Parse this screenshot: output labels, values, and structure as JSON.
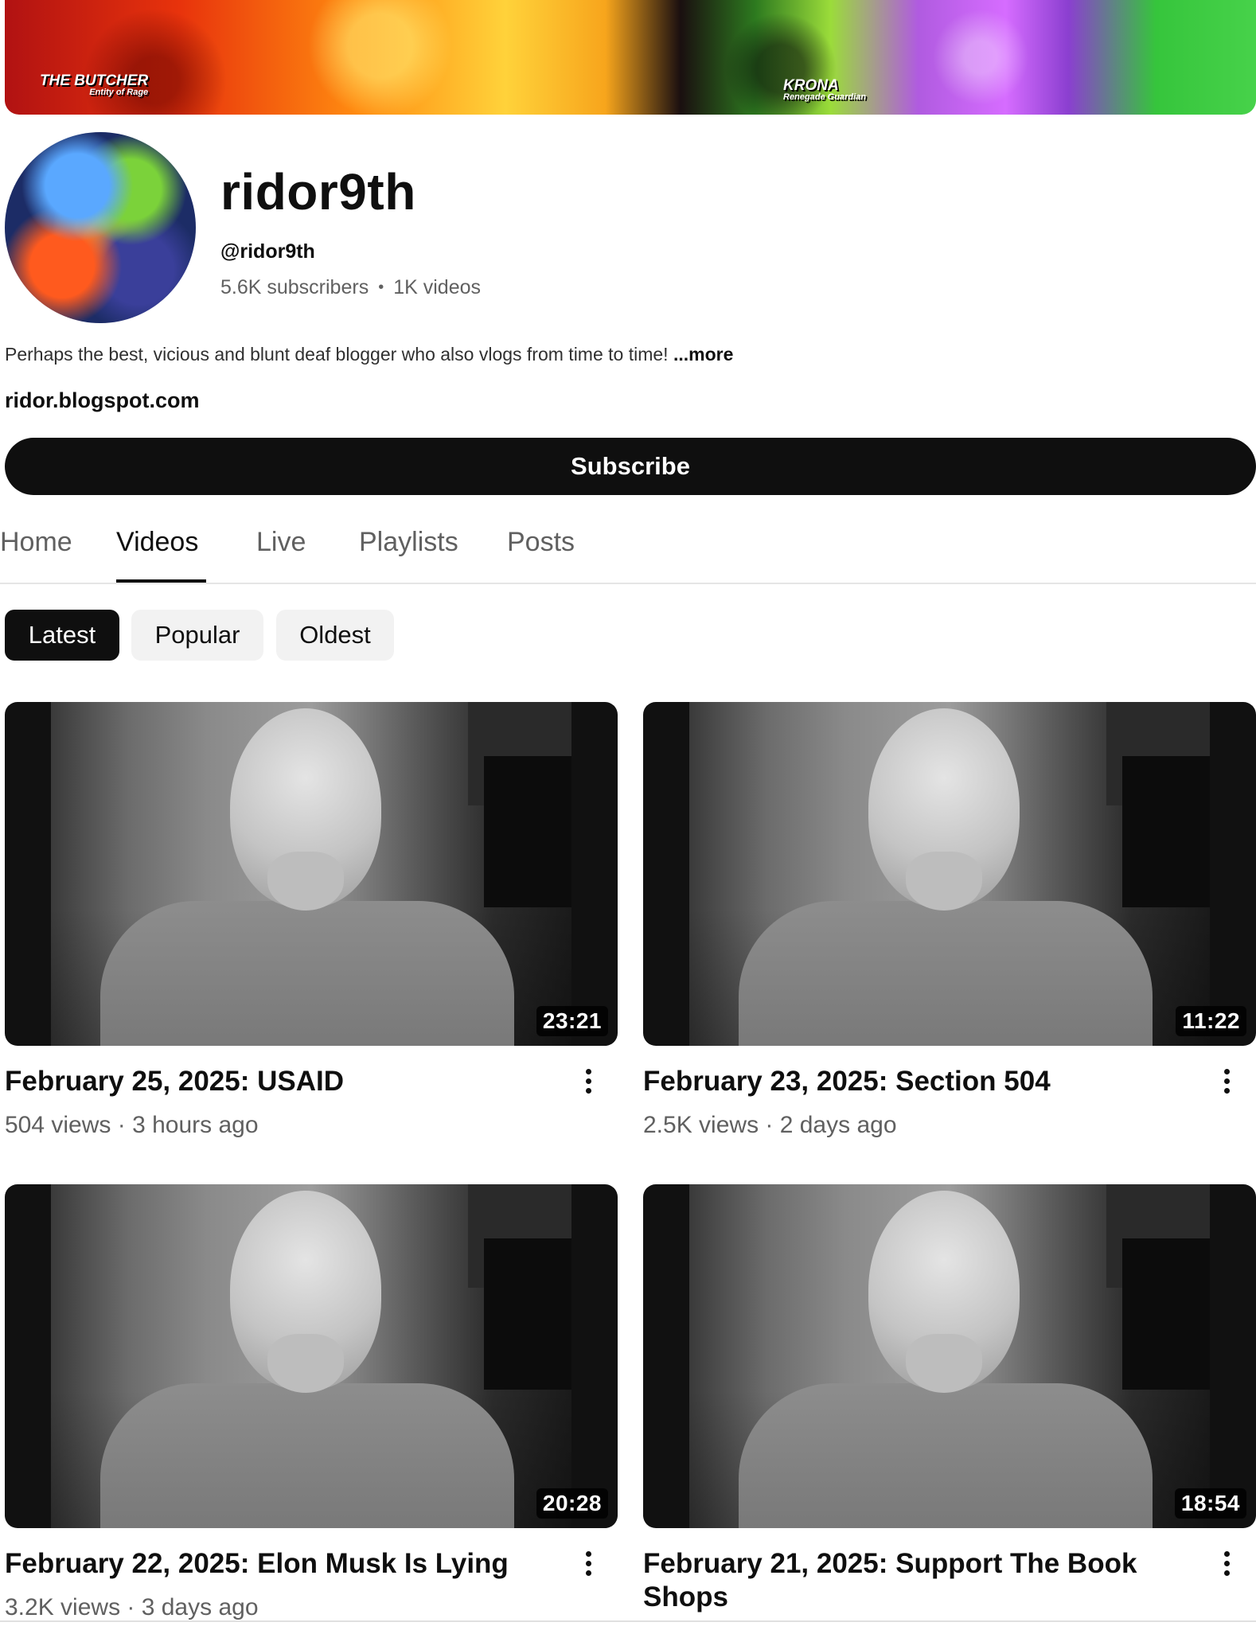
{
  "banner": {
    "label_left_name": "THE BUTCHER",
    "label_left_sub": "Entity of Rage",
    "label_right_name": "KRONA",
    "label_right_sub": "Renegade Guardian"
  },
  "channel": {
    "name": "ridor9th",
    "handle": "@ridor9th",
    "subscribers": "5.6K subscribers",
    "separator": "•",
    "videos": "1K videos",
    "description": "Perhaps the best, vicious and blunt deaf blogger who also vlogs from time to time! ",
    "more_label": "...more",
    "link": "ridor.blogspot.com",
    "subscribe_label": "Subscribe"
  },
  "tabs": [
    {
      "label": "Home",
      "active": false
    },
    {
      "label": "Videos",
      "active": true
    },
    {
      "label": "Live",
      "active": false
    },
    {
      "label": "Playlists",
      "active": false
    },
    {
      "label": "Posts",
      "active": false
    }
  ],
  "chips": [
    {
      "label": "Latest",
      "selected": true
    },
    {
      "label": "Popular",
      "selected": false
    },
    {
      "label": "Oldest",
      "selected": false
    }
  ],
  "videos": [
    {
      "title": "February 25, 2025: USAID",
      "duration": "23:21",
      "meta": "504 views · 3 hours ago"
    },
    {
      "title": "February 23, 2025:  Section 504",
      "duration": "11:22",
      "meta": "2.5K views · 2 days ago"
    },
    {
      "title": "February 22, 2025: Elon Musk Is Lying",
      "duration": "20:28",
      "meta": "3.2K views · 3 days ago"
    },
    {
      "title": "February 21, 2025: Support The Book Shops",
      "duration": "18:54",
      "meta": ""
    }
  ],
  "icons": {
    "more_options": "kebab-vertical-icon"
  }
}
